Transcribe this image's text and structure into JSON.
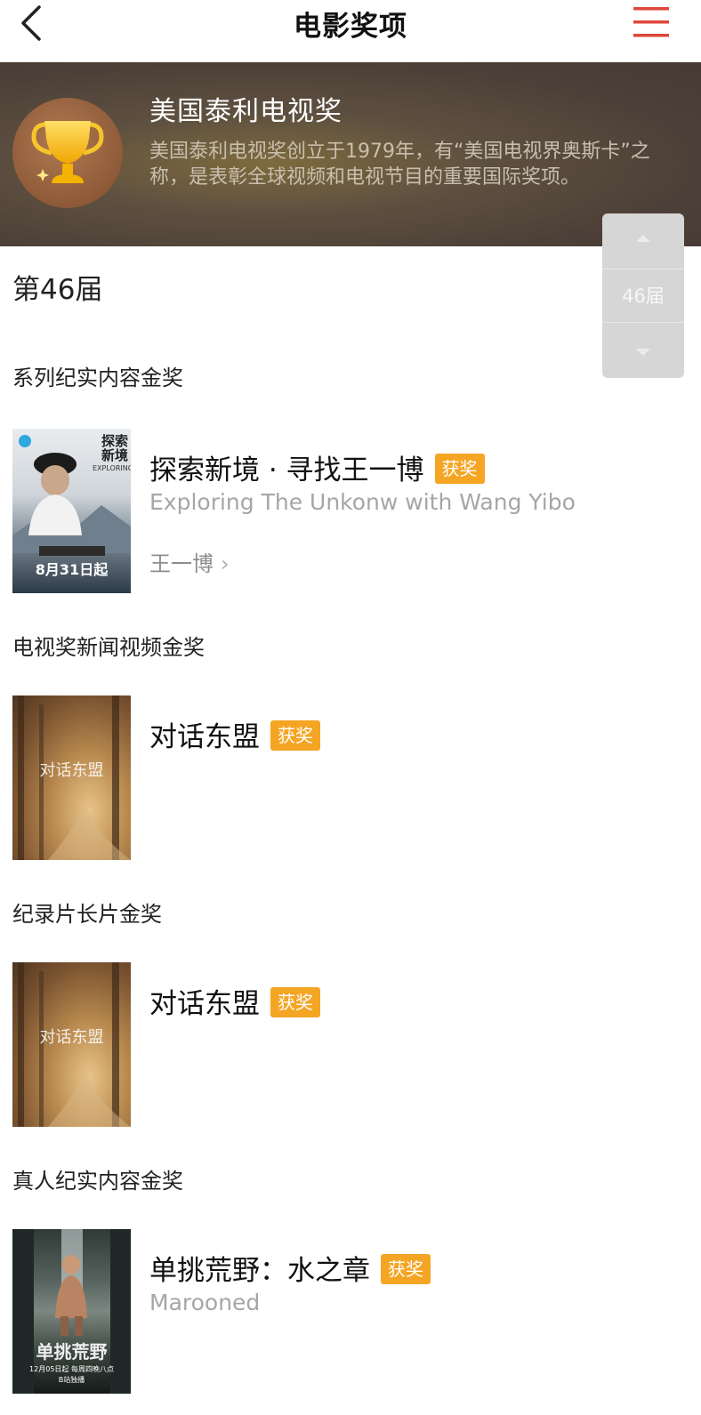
{
  "nav": {
    "title": "电影奖项"
  },
  "award": {
    "name": "美国泰利电视奖",
    "description": "美国泰利电视奖创立于1979年，有“美国电视界奥斯卡”之称，是表彰全球视频和电视节目的重要国际奖项。"
  },
  "edition": {
    "label": "第46届",
    "picker_value": "46届"
  },
  "win_badge": "获奖",
  "categories": [
    {
      "name": "系列纪实内容金奖",
      "work": {
        "title": "探索新境 · 寻找王一博",
        "subtitle": "Exploring The Unkonw with Wang Yibo",
        "person": "王一博",
        "poster": {
          "title": "探索新境",
          "en": "EXPLORING",
          "date": "8月31日起"
        }
      }
    },
    {
      "name": "电视奖新闻视频金奖",
      "work": {
        "title": "对话东盟",
        "poster": {
          "title": "对话东盟"
        }
      }
    },
    {
      "name": "纪录片长片金奖",
      "work": {
        "title": "对话东盟",
        "poster": {
          "title": "对话东盟"
        }
      }
    },
    {
      "name": "真人纪实内容金奖",
      "work": {
        "title": "单挑荒野：水之章",
        "subtitle": "Marooned",
        "poster": {
          "title": "单挑荒野",
          "date": "12月05日起 每周四晚八点",
          "note": "B站独播"
        }
      }
    }
  ],
  "colors": {
    "badge": "#f5a524",
    "menu_icon": "#e0453a",
    "hero_bg": "#5a4c3e"
  },
  "icons": {
    "back": "chevron-left-icon",
    "menu": "hamburger-menu-icon",
    "trophy": "trophy-icon"
  }
}
